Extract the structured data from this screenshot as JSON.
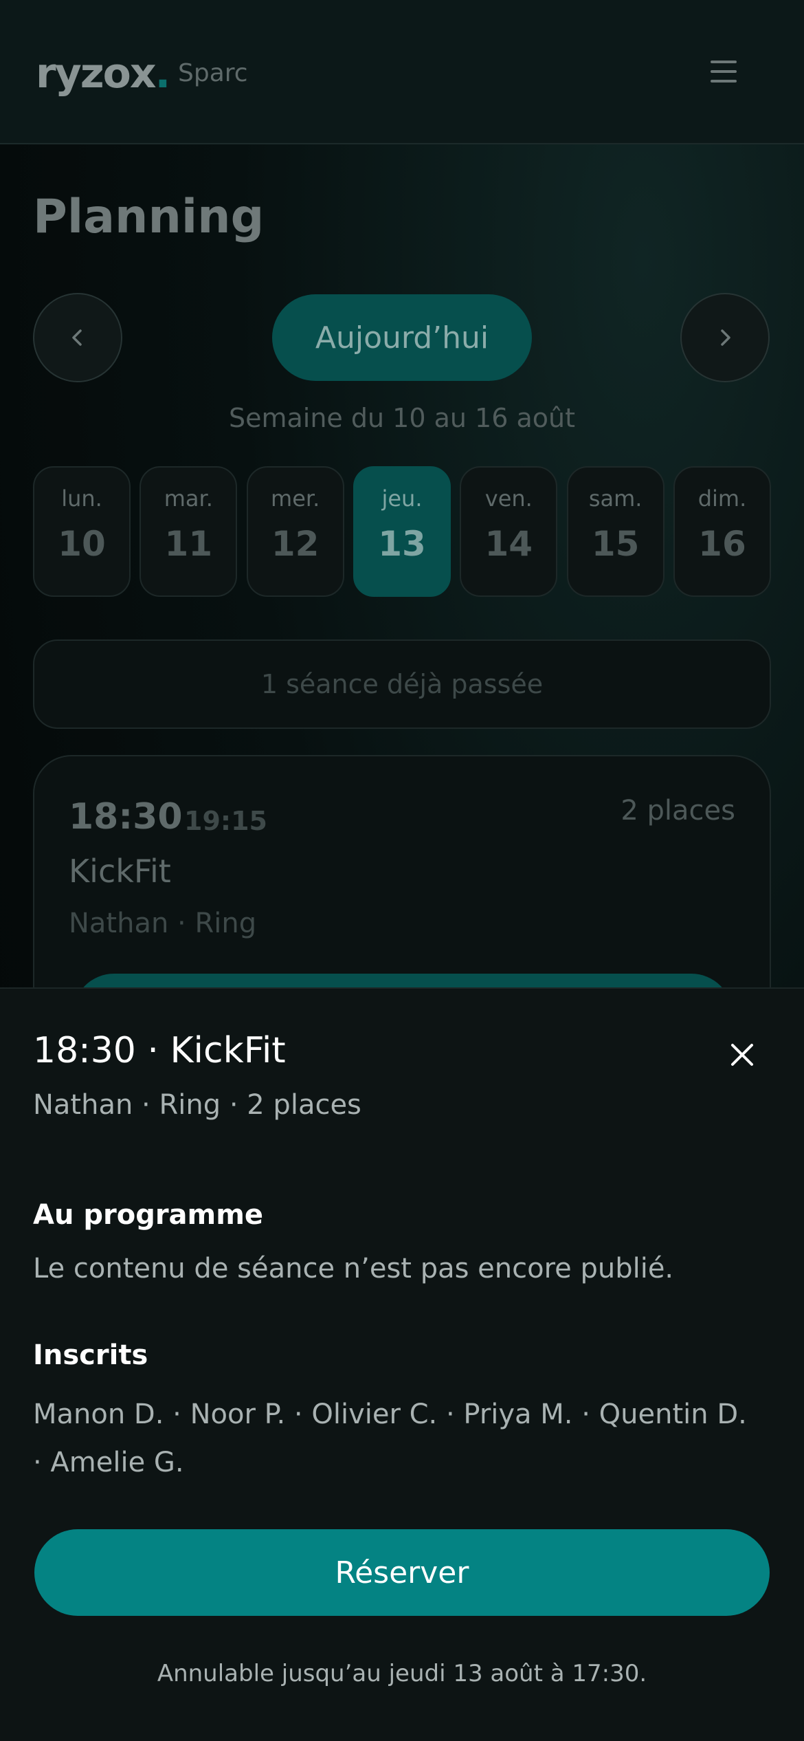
{
  "header": {
    "logo": "ryzox",
    "logo_dot": ".",
    "club": "Sparc"
  },
  "page_title": "Planning",
  "nav": {
    "today": "Aujourd’hui",
    "week": "Semaine du 10 au 16 août"
  },
  "days": [
    {
      "name": "lun.",
      "num": "10"
    },
    {
      "name": "mar.",
      "num": "11"
    },
    {
      "name": "mer.",
      "num": "12"
    },
    {
      "name": "jeu.",
      "num": "13",
      "active": true
    },
    {
      "name": "ven.",
      "num": "14"
    },
    {
      "name": "sam.",
      "num": "15"
    },
    {
      "name": "dim.",
      "num": "16"
    }
  ],
  "past_sessions": "1 séance déjà passée",
  "card": {
    "start": "18:30",
    "end": "19:15",
    "places": "2 places",
    "name": "KickFit",
    "meta": "Nathan · Ring"
  },
  "sheet": {
    "title": "18:30 · KickFit",
    "meta": "Nathan · Ring · 2 places",
    "program_heading": "Au programme",
    "program_text": "Le contenu de séance n’est pas encore publié.",
    "registered_heading": "Inscrits",
    "registered_text": "Manon D. · Noor P. · Olivier C. · Priya M. · Quentin D. · Amelie G.",
    "reserve_label": "Réserver",
    "cancel_note": "Annulable jusqu’au jeudi 13 août à 17:30."
  },
  "colors": {
    "accent": "#048383",
    "accent_dim": "#064f4d",
    "background": "#040707",
    "sheet": "#0d1414"
  }
}
